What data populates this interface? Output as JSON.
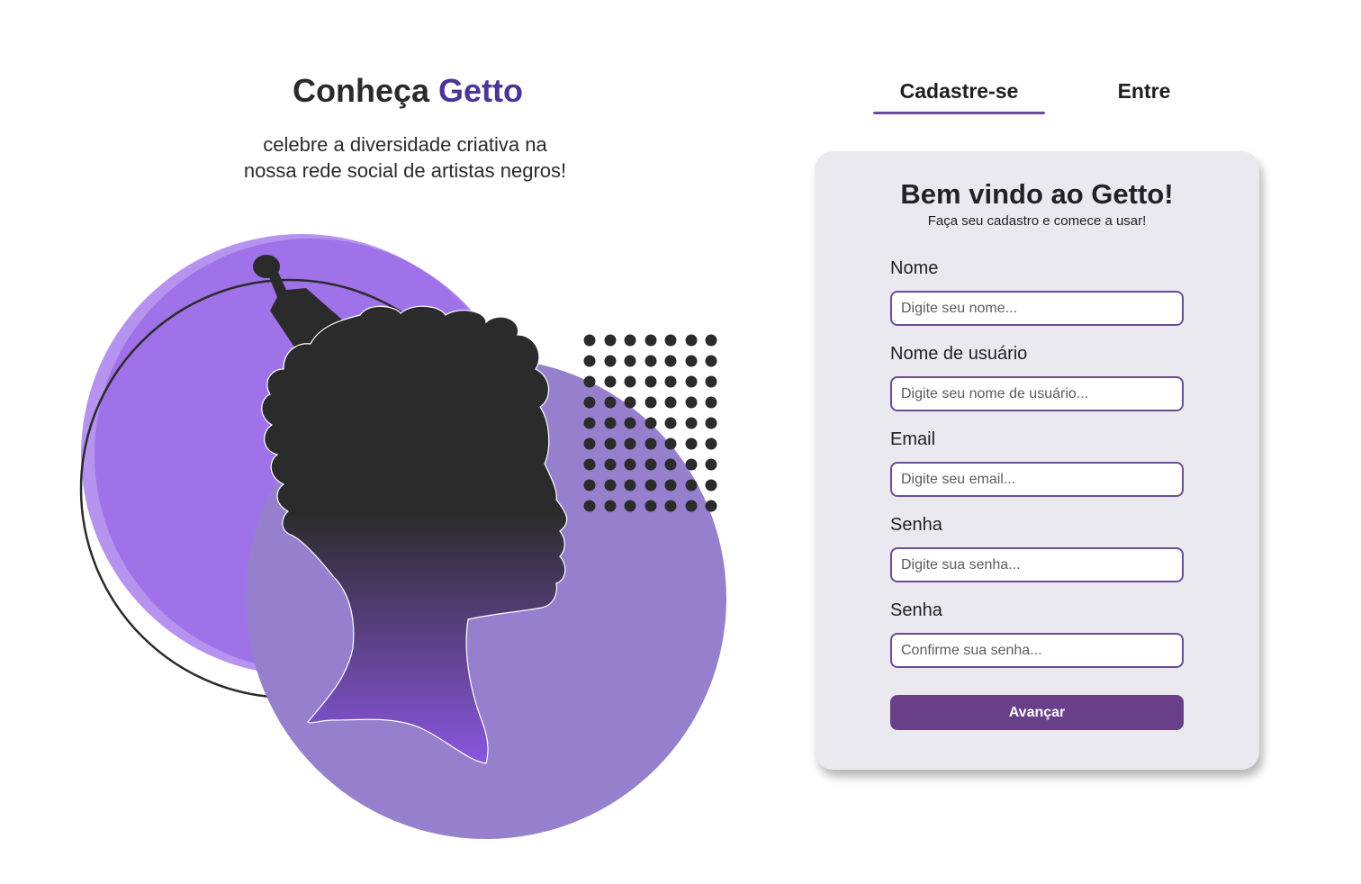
{
  "hero": {
    "title_prefix": "Conheça ",
    "title_brand": "Getto",
    "subtitle_line1": "celebre a diversidade criativa na",
    "subtitle_line2": "nossa rede social de artistas negros!"
  },
  "tabs": {
    "signup_label": "Cadastre-se",
    "login_label": "Entre",
    "active": "signup"
  },
  "form": {
    "title": "Bem vindo ao Getto!",
    "subtitle": "Faça seu cadastro e comece a usar!",
    "fields": [
      {
        "label": "Nome",
        "placeholder": "Digite seu nome...",
        "value": ""
      },
      {
        "label": "Nome de usuário",
        "placeholder": "Digite seu nome de usuário...",
        "value": ""
      },
      {
        "label": "Email",
        "placeholder": "Digite seu email...",
        "value": ""
      },
      {
        "label": "Senha",
        "placeholder": "Digite sua senha...",
        "value": ""
      },
      {
        "label": "Senha",
        "placeholder": "Confirme sua senha...",
        "value": ""
      }
    ],
    "submit_label": "Avançar"
  },
  "colors": {
    "brand": "#4b3596",
    "accent": "#6a3f8a",
    "input_border": "#6a4c93",
    "card_bg": "#ebe9f0",
    "circle_light": "#b593ef",
    "circle_mid": "#9b6ce8",
    "circle_large": "#9680ce",
    "silhouette": "#2b2b2b"
  },
  "icons": {
    "illustration": "woman-silhouette-with-afro-comb",
    "pattern": "dot-grid"
  }
}
